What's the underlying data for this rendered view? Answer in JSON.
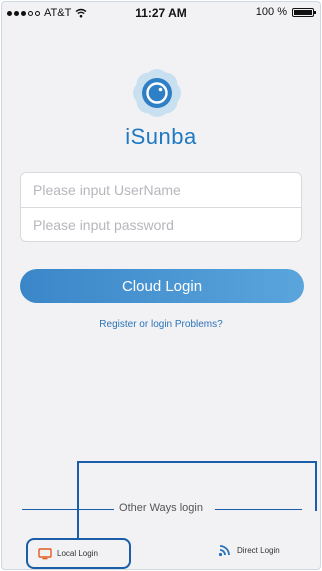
{
  "status_bar": {
    "carrier": "AT&T",
    "time": "11:27 AM",
    "battery": "100 %"
  },
  "app": {
    "name": "iSunba"
  },
  "form": {
    "username_placeholder": "Please input UserName",
    "password_placeholder": "Please input password",
    "username_value": "",
    "password_value": ""
  },
  "actions": {
    "cloud_login_label": "Cloud Login",
    "register_link": "Register or login Problems?"
  },
  "other_ways": {
    "title": "Other Ways login",
    "local_login": "Local Login",
    "direct_login": "Direct Login"
  },
  "colors": {
    "brand": "#1e78c2",
    "button_gradient_start": "#3a86c8",
    "button_gradient_end": "#5aa5dc",
    "local_icon": "#e35a1c",
    "direct_icon": "#2a73b8"
  }
}
